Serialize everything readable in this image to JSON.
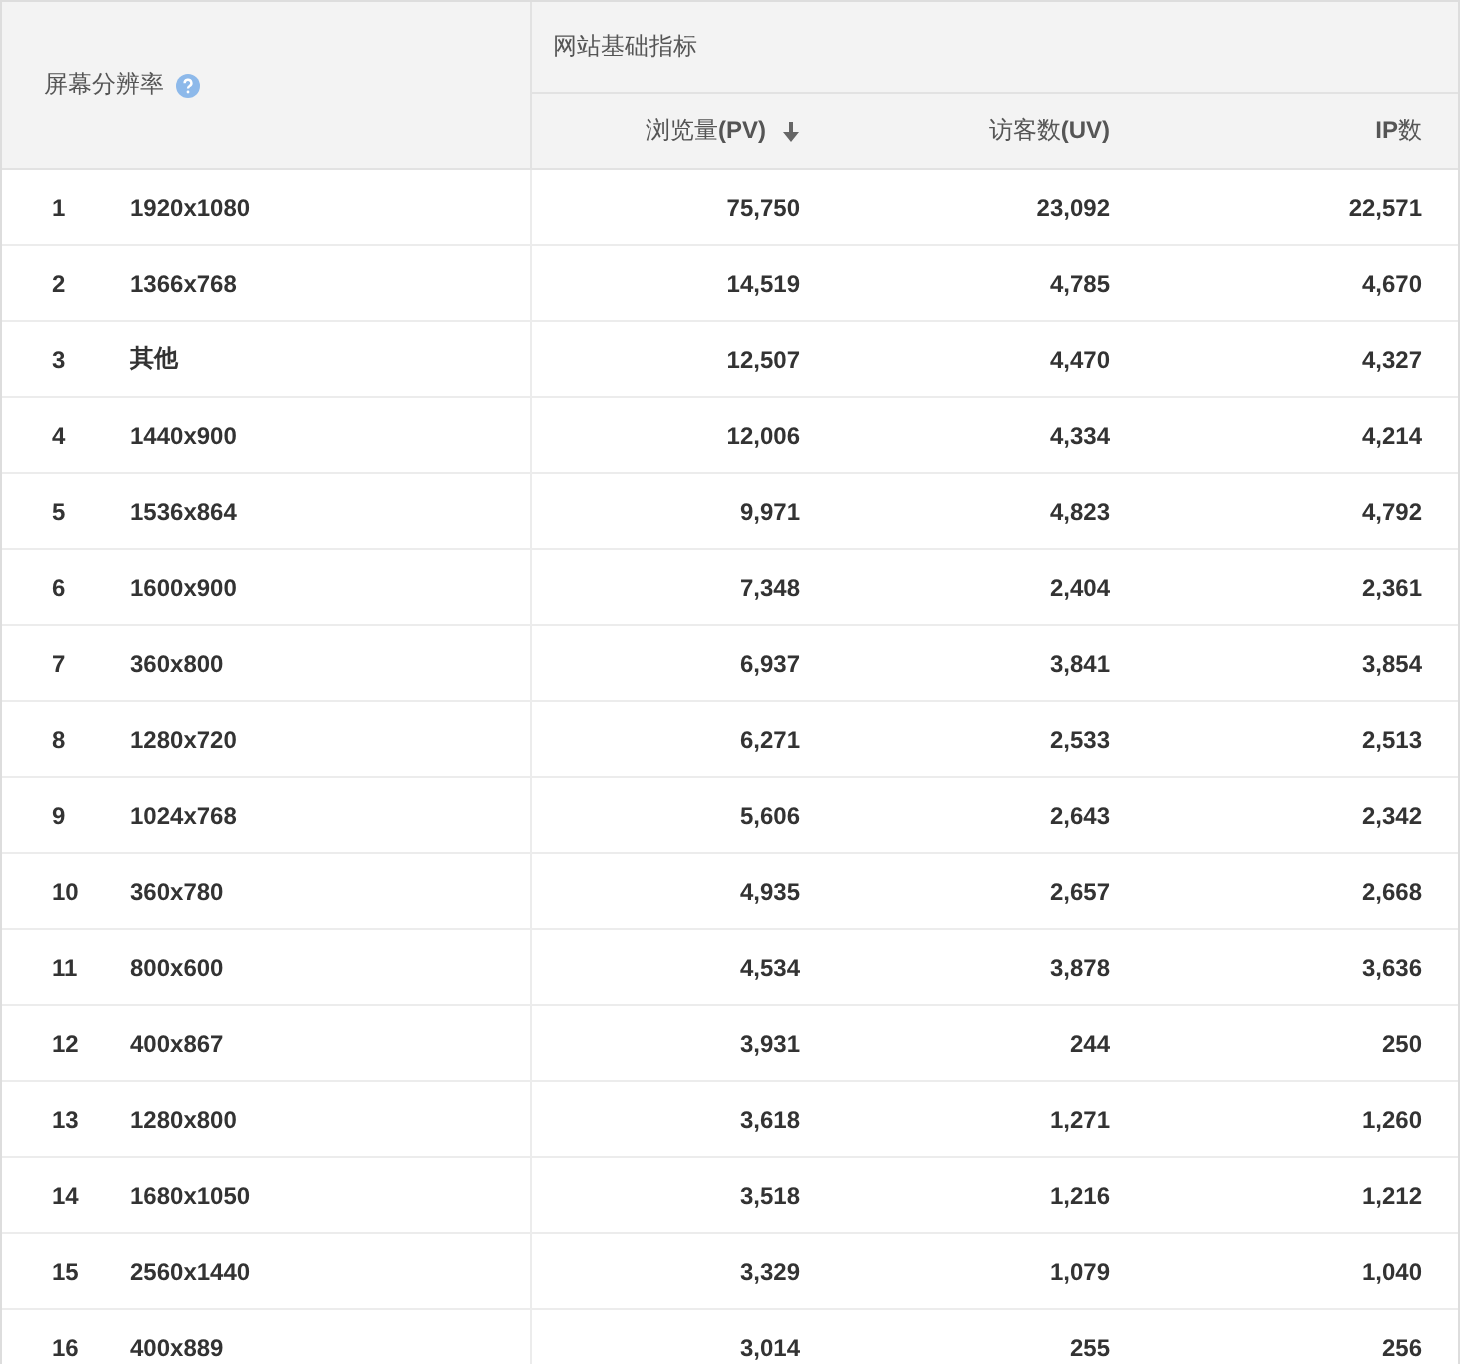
{
  "table": {
    "dimension_header": "屏幕分辨率",
    "group_header": "网站基础指标",
    "columns": [
      {
        "label": "浏览量**(PV)**",
        "sorted": true
      },
      {
        "label": "访客数**(UV)**",
        "sorted": false
      },
      {
        "label": "**IP**数",
        "sorted": false
      }
    ],
    "rows": [
      {
        "rank": "1",
        "resolution": "1920x1080",
        "values": [
          "75,750",
          "23,092",
          "22,571"
        ]
      },
      {
        "rank": "2",
        "resolution": "1366x768",
        "values": [
          "14,519",
          "4,785",
          "4,670"
        ]
      },
      {
        "rank": "3",
        "resolution": "其他",
        "values": [
          "12,507",
          "4,470",
          "4,327"
        ]
      },
      {
        "rank": "4",
        "resolution": "1440x900",
        "values": [
          "12,006",
          "4,334",
          "4,214"
        ]
      },
      {
        "rank": "5",
        "resolution": "1536x864",
        "values": [
          "9,971",
          "4,823",
          "4,792"
        ]
      },
      {
        "rank": "6",
        "resolution": "1600x900",
        "values": [
          "7,348",
          "2,404",
          "2,361"
        ]
      },
      {
        "rank": "7",
        "resolution": "360x800",
        "values": [
          "6,937",
          "3,841",
          "3,854"
        ]
      },
      {
        "rank": "8",
        "resolution": "1280x720",
        "values": [
          "6,271",
          "2,533",
          "2,513"
        ]
      },
      {
        "rank": "9",
        "resolution": "1024x768",
        "values": [
          "5,606",
          "2,643",
          "2,342"
        ]
      },
      {
        "rank": "10",
        "resolution": "360x780",
        "values": [
          "4,935",
          "2,657",
          "2,668"
        ]
      },
      {
        "rank": "11",
        "resolution": "800x600",
        "values": [
          "4,534",
          "3,878",
          "3,636"
        ]
      },
      {
        "rank": "12",
        "resolution": "400x867",
        "values": [
          "3,931",
          "244",
          "250"
        ]
      },
      {
        "rank": "13",
        "resolution": "1280x800",
        "values": [
          "3,618",
          "1,271",
          "1,260"
        ]
      },
      {
        "rank": "14",
        "resolution": "1680x1050",
        "values": [
          "3,518",
          "1,216",
          "1,212"
        ]
      },
      {
        "rank": "15",
        "resolution": "2560x1440",
        "values": [
          "3,329",
          "1,079",
          "1,040"
        ]
      },
      {
        "rank": "16",
        "resolution": "400x889",
        "values": [
          "3,014",
          "255",
          "256"
        ]
      }
    ]
  }
}
